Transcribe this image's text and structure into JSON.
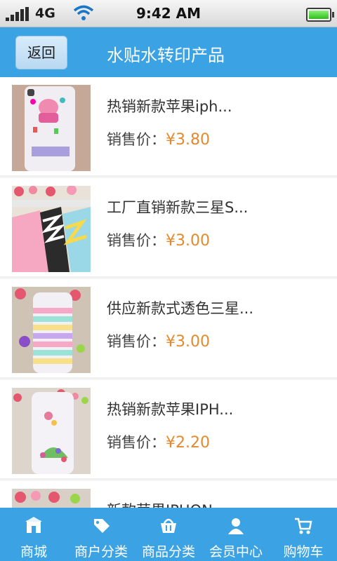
{
  "status_bar": {
    "network": "4G",
    "time": "9:42 AM"
  },
  "header": {
    "back_label": "返回",
    "title": "水贴水转印产品"
  },
  "products": [
    {
      "name": "热销新款苹果iph...",
      "price_label": "销售价：",
      "price": "¥3.80"
    },
    {
      "name": "工厂直销新款三星S...",
      "price_label": "销售价：",
      "price": "¥3.00"
    },
    {
      "name": "供应新款式透色三星...",
      "price_label": "销售价：",
      "price": "¥3.00"
    },
    {
      "name": "热销新款苹果IPH...",
      "price_label": "销售价：",
      "price": "¥2.20"
    },
    {
      "name": "新款苹果IPHON..."
    }
  ],
  "bottom_nav": [
    {
      "label": "商城",
      "icon": "home-icon"
    },
    {
      "label": "商户分类",
      "icon": "tag-icon"
    },
    {
      "label": "商品分类",
      "icon": "basket-icon"
    },
    {
      "label": "会员中心",
      "icon": "user-icon"
    },
    {
      "label": "购物车",
      "icon": "cart-icon"
    }
  ],
  "colors": {
    "header": "#3ba3e3",
    "price": "#e38a2e"
  }
}
